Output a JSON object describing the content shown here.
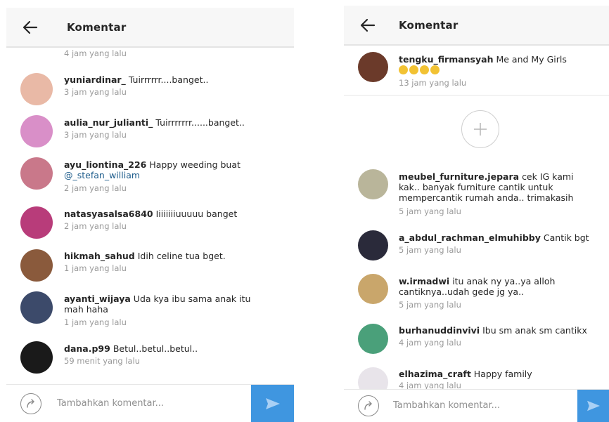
{
  "left": {
    "header": {
      "title": "Komentar"
    },
    "top_time": "4 jam yang lalu",
    "comments": [
      {
        "username": "yuniardinar_",
        "text": "Tuirrrrrr....banget..",
        "time": "3 jam yang lalu",
        "avatar_color": "#e9b9a6"
      },
      {
        "username": "aulia_nur_julianti_",
        "text": "Tuirrrrrrr......banget..",
        "time": "3 jam yang lalu",
        "avatar_color": "#d98fc8"
      },
      {
        "username": "ayu_liontina_226",
        "text": "Happy weeding buat",
        "mention": "@_stefan_william",
        "time": "2 jam yang lalu",
        "avatar_color": "#c9788a"
      },
      {
        "username": "natasyasalsa6840",
        "text": "Iiiiiiiiuuuuu banget",
        "time": "2 jam yang lalu",
        "avatar_color": "#b83c7a"
      },
      {
        "username": "hikmah_sahud",
        "text": "Idih celine tua bget.",
        "time": "1 jam yang lalu",
        "avatar_color": "#8a5a3c"
      },
      {
        "username": "ayanti_wijaya",
        "text": "Uda kya ibu sama anak itu mah haha",
        "time": "1 jam yang lalu",
        "avatar_color": "#3c4a6a"
      },
      {
        "username": "dana.p99",
        "text": "Betul..betul..betul..",
        "time": "59 menit yang lalu",
        "avatar_color": "#1a1a1a"
      }
    ],
    "input": {
      "placeholder": "Tambahkan komentar..."
    }
  },
  "right": {
    "header": {
      "title": "Komentar"
    },
    "caption": {
      "username": "tengku_firmansyah",
      "text": "Me and My Girls",
      "emoji_count": 4,
      "time": "13 jam yang lalu",
      "avatar_color": "#6b3a2a"
    },
    "comments": [
      {
        "username": "meubel_furniture.jepara",
        "text": "cek IG kami kak.. banyak furniture cantik untuk mempercantik rumah anda.. trimakasih",
        "time": "5 jam yang lalu",
        "avatar_color": "#b9b59a"
      },
      {
        "username": "a_abdul_rachman_elmuhibby",
        "text": "Cantik bgt",
        "time": "5 jam yang lalu",
        "avatar_color": "#2a2a3a"
      },
      {
        "username": "w.irmadwi",
        "text": "itu anak ny ya..ya alloh cantiknya..udah gede jg ya..",
        "time": "5 jam yang lalu",
        "avatar_color": "#c9a66b"
      },
      {
        "username": "burhanuddinvivi",
        "text": "Ibu sm anak sm cantikx",
        "time": "4 jam yang lalu",
        "avatar_color": "#4aa07a"
      },
      {
        "username": "elhazima_craft",
        "text": "Happy family",
        "time": "4 jam yang lalu",
        "avatar_color": "#e8e4ea"
      }
    ],
    "input": {
      "placeholder": "Tambahkan komentar..."
    }
  },
  "colors": {
    "send_button": "#3f96e0",
    "mention": "#1e5d8c",
    "time": "#9a9a9a",
    "emoji": "#f2c233"
  }
}
